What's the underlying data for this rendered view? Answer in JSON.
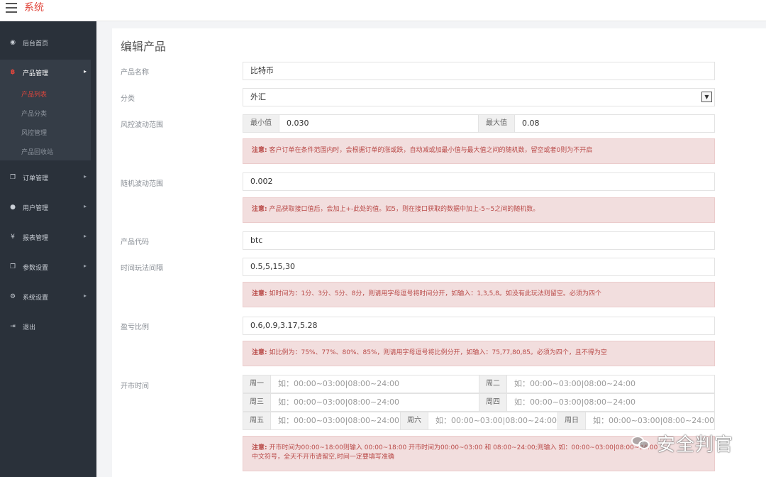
{
  "topbar": {
    "brand": "系统",
    "menu_icon": "hamburger-icon"
  },
  "sidebar": {
    "items": [
      {
        "label": "后台首页",
        "icon": "dashboard-icon"
      },
      {
        "label": "产品管理",
        "icon": "bitcoin-icon",
        "active": true
      },
      {
        "label": "订单管理",
        "icon": "copy-icon"
      },
      {
        "label": "用户管理",
        "icon": "user-icon"
      },
      {
        "label": "报表管理",
        "icon": "yen-icon"
      },
      {
        "label": "参数设置",
        "icon": "copy-icon"
      },
      {
        "label": "系统设置",
        "icon": "gears-icon"
      },
      {
        "label": "退出",
        "icon": "sign-out-icon"
      }
    ],
    "sub_items": [
      {
        "label": "产品列表",
        "current": true
      },
      {
        "label": "产品分类"
      },
      {
        "label": "风控管理"
      },
      {
        "label": "产品回收站"
      }
    ]
  },
  "form": {
    "title": "编辑产品",
    "name": {
      "label": "产品名称",
      "value": "比特币"
    },
    "category": {
      "label": "分类",
      "value": "外汇"
    },
    "risk": {
      "label": "风控波动范围",
      "min_label": "最小值",
      "min_value": "0.030",
      "max_label": "最大值",
      "max_value": "0.08",
      "note_prefix": "注意:",
      "note": "客户订单在条件范围内时，会根据订单的涨或跌，自动减或加最小值与最大值之间的随机数，留空或者0则为不开启"
    },
    "random": {
      "label": "随机波动范围",
      "value": "0.002",
      "note_prefix": "注意:",
      "note": "产品获取接口值后，会加上+-此处的值。如5，则在接口获取的数据中加上-5~5之间的随机数。"
    },
    "code": {
      "label": "产品代码",
      "value": "btc"
    },
    "interval": {
      "label": "时间玩法间隔",
      "value": "0.5,5,15,30",
      "note_prefix": "注意:",
      "note": "如时间为：1分、3分、5分、8分，则请用字母逗号将时间分开，如输入：1,3,5,8。如没有此玩法则留空。必须为四个"
    },
    "ratio": {
      "label": "盈亏比例",
      "value": "0.6,0.9,3.17,5.28",
      "note_prefix": "注意:",
      "note": "如比例为：75%、77%、80%、85%，则请用字母逗号将比例分开，如输入：75,77,80,85。必须为四个，且不得为空"
    },
    "market": {
      "label": "开市时间",
      "days": [
        "周一",
        "周二",
        "周三",
        "周四",
        "周五",
        "周六",
        "周日"
      ],
      "placeholder": "如：00:00~03:00|08:00~24:00",
      "note_prefix": "注意:",
      "note": "开市时间为00:00~18:00则输入 00:00~18:00 开市时间为00:00~03:00 和 08:00~24:00;则输入 如：00:00~03:00|08:00~24:00",
      "note_line2": "中文符号，全天不开市请留空,时间一定要填写准确"
    }
  },
  "watermark": {
    "text": "安全判官",
    "icon": "wechat-icon"
  }
}
